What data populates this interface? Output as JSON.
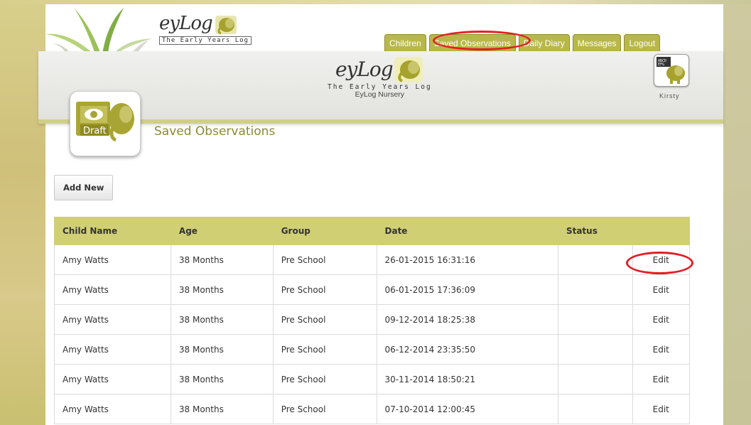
{
  "header": {
    "logo_text": "eyLog",
    "logo_tagline": "The Early Years Log",
    "tabs": [
      {
        "label": "Children"
      },
      {
        "label": "Saved Observations"
      },
      {
        "label": "Daily Diary"
      },
      {
        "label": "Messages"
      },
      {
        "label": "Logout"
      }
    ]
  },
  "banner": {
    "logo_text": "eyLog",
    "logo_tagline": "The Early Years Log",
    "nursery_name": "EyLog Nursery",
    "user_name": "Kirsty"
  },
  "section": {
    "icon_label": "Draft",
    "title": "Saved Observations"
  },
  "actions": {
    "add_new_label": "Add New"
  },
  "table": {
    "headers": [
      "Child Name",
      "Age",
      "Group",
      "Date",
      "Status",
      ""
    ],
    "rows": [
      {
        "child": "Amy Watts",
        "age": "38 Months",
        "group": "Pre School",
        "date": "26-01-2015 16:31:16",
        "status": "",
        "action": "Edit"
      },
      {
        "child": "Amy Watts",
        "age": "38 Months",
        "group": "Pre School",
        "date": "06-01-2015 17:36:09",
        "status": "",
        "action": "Edit"
      },
      {
        "child": "Amy Watts",
        "age": "38 Months",
        "group": "Pre School",
        "date": "09-12-2014 18:25:38",
        "status": "",
        "action": "Edit"
      },
      {
        "child": "Amy Watts",
        "age": "38 Months",
        "group": "Pre School",
        "date": "06-12-2014 23:35:50",
        "status": "",
        "action": "Edit"
      },
      {
        "child": "Amy Watts",
        "age": "38 Months",
        "group": "Pre School",
        "date": "30-11-2014 18:50:21",
        "status": "",
        "action": "Edit"
      },
      {
        "child": "Amy Watts",
        "age": "38 Months",
        "group": "Pre School",
        "date": "07-10-2014 12:00:45",
        "status": "",
        "action": "Edit"
      }
    ]
  },
  "colors": {
    "accent_olive": "#b8b84a",
    "table_header": "#d0cf74",
    "annotation_red": "#e41e26",
    "title_olive": "#8a8a30"
  },
  "icons": [
    "leaves-decoration",
    "elephant-logo-icon",
    "user-avatar-icon",
    "draft-observation-icon"
  ]
}
